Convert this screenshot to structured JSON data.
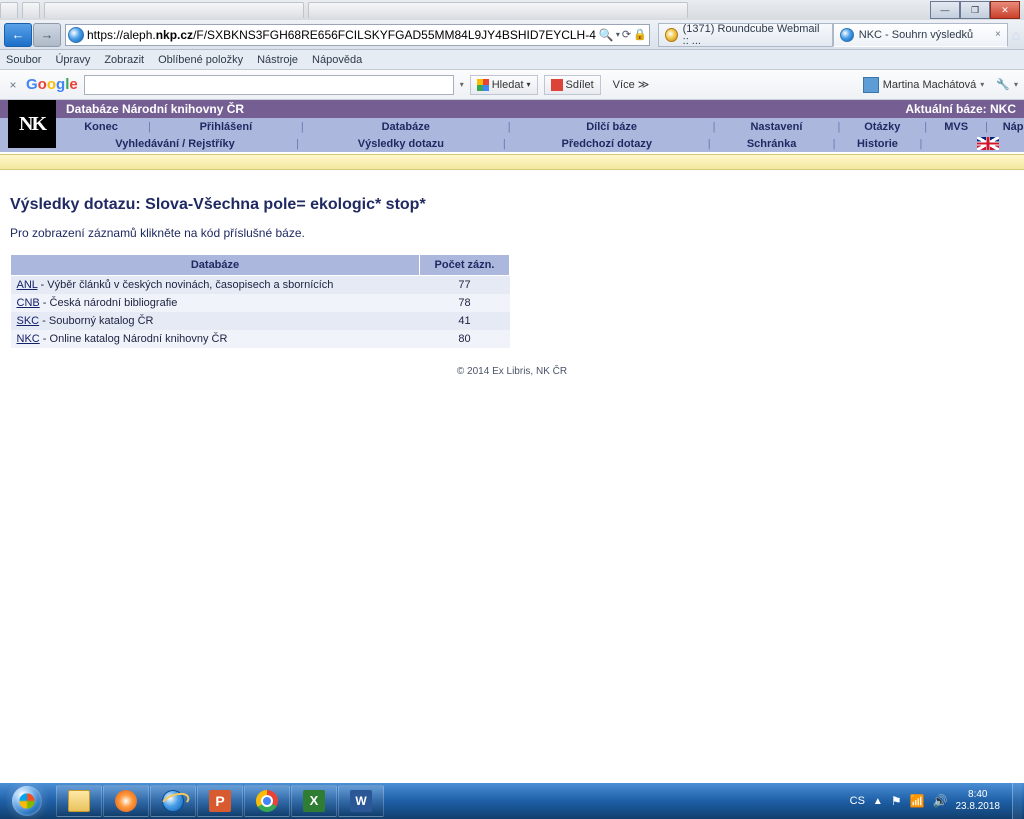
{
  "window": {
    "min": "—",
    "max": "❐",
    "close": "✕",
    "home_icon": "⌂",
    "star_icon": "☆",
    "gear_icon": "✲"
  },
  "ie": {
    "back": "←",
    "forward": "→",
    "url_prefix": "https",
    "url_host_pre": "://aleph.",
    "url_host_bold": "nkp.cz",
    "url_path": "/F/SXBKNS3FGH68RE656FCILSKYFGAD55MM84L9JY4BSHID7EYCLH-4",
    "search_icon": "🔍",
    "dropdown": "▾",
    "refresh": "⟳",
    "lock": "🔒",
    "tab1": "(1371) Roundcube Webmail :: ...",
    "tab2": "NKC - Souhrn výsledků",
    "tab_close": "×"
  },
  "ie_menu": [
    "Soubor",
    "Úpravy",
    "Zobrazit",
    "Oblíbené položky",
    "Nástroje",
    "Nápověda"
  ],
  "gbar": {
    "close": "×",
    "logo": [
      "G",
      "o",
      "o",
      "g",
      "l",
      "e"
    ],
    "search_btn": "Hledat",
    "search_dd": "▾",
    "share_btn": "Sdílet",
    "more": "Více ≫",
    "user": "Martina Machátová",
    "user_dd": "▾",
    "wrench": "🔧",
    "wrench_dd": "▾"
  },
  "library": {
    "title": "Databáze Národní knihovny ČR",
    "current_base_label": "Aktuální báze:  NKC",
    "row1": [
      "Konec",
      "Přihlášení",
      "Databáze",
      "Dílčí báze",
      "Nastavení",
      "Otázky",
      "MVS",
      "Nápověda"
    ],
    "row2": [
      "Vyhledávání / Rejstříky",
      "Výsledky dotazu",
      "Předchozí dotazy",
      "Schránka",
      "Historie"
    ]
  },
  "page": {
    "heading": "Výsledky dotazu:  Slova-Všechna pole= ekologic* stop*",
    "hint": "Pro zobrazení záznamů klikněte na kód příslušné báze.",
    "th1": "Databáze",
    "th2": "Počet zázn.",
    "rows": [
      {
        "code": "ANL",
        "desc": "Výběr článků v českých novinách, časopisech a sbornících",
        "count": "77"
      },
      {
        "code": "CNB",
        "desc": "Česká národní bibliografie",
        "count": "78"
      },
      {
        "code": "SKC",
        "desc": "Souborný katalog ČR",
        "count": "41"
      },
      {
        "code": "NKC",
        "desc": "Online katalog Národní knihovny ČR",
        "count": "80"
      }
    ],
    "footer": "© 2014 Ex Libris, NK ČR"
  },
  "taskbar": {
    "lang": "CS",
    "up": "▲",
    "flag": "⚑",
    "net": "📶",
    "vol": "🔊",
    "time": "8:40",
    "date": "23.8.2018"
  },
  "sep": "|",
  "dash": "  -  "
}
